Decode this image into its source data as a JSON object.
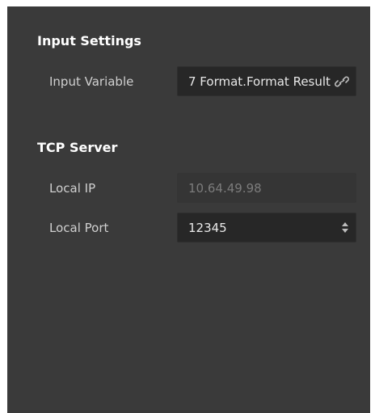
{
  "input_settings": {
    "title": "Input Settings",
    "input_variable": {
      "label": "Input Variable",
      "value": "7 Format.Format Result"
    }
  },
  "tcp_server": {
    "title": "TCP Server",
    "local_ip": {
      "label": "Local IP",
      "value": "10.64.49.98"
    },
    "local_port": {
      "label": "Local Port",
      "value": "12345"
    }
  },
  "icons": {
    "link": "link-icon",
    "stepper": "spinner-arrows-icon"
  },
  "colors": {
    "panel_background": "#3a3a3a",
    "field_background": "#272727",
    "title_text": "#ffffff",
    "label_text": "#d0d0d0",
    "disabled_text": "#7c7c7c"
  }
}
